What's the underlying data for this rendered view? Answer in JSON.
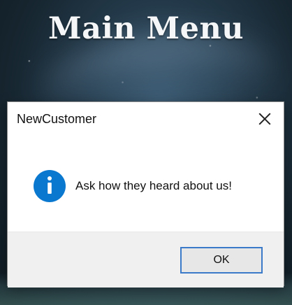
{
  "background": {
    "title": "Main Menu"
  },
  "dialog": {
    "title": "NewCustomer",
    "message": "Ask how they heard about us!",
    "ok_label": "OK"
  },
  "icons": {
    "close": "close-icon",
    "info": "info-icon"
  },
  "colors": {
    "dialog_background": "#ffffff",
    "footer_background": "#f0f0f0",
    "button_border": "#3b7ac8",
    "info_icon": "#0b78d0"
  }
}
